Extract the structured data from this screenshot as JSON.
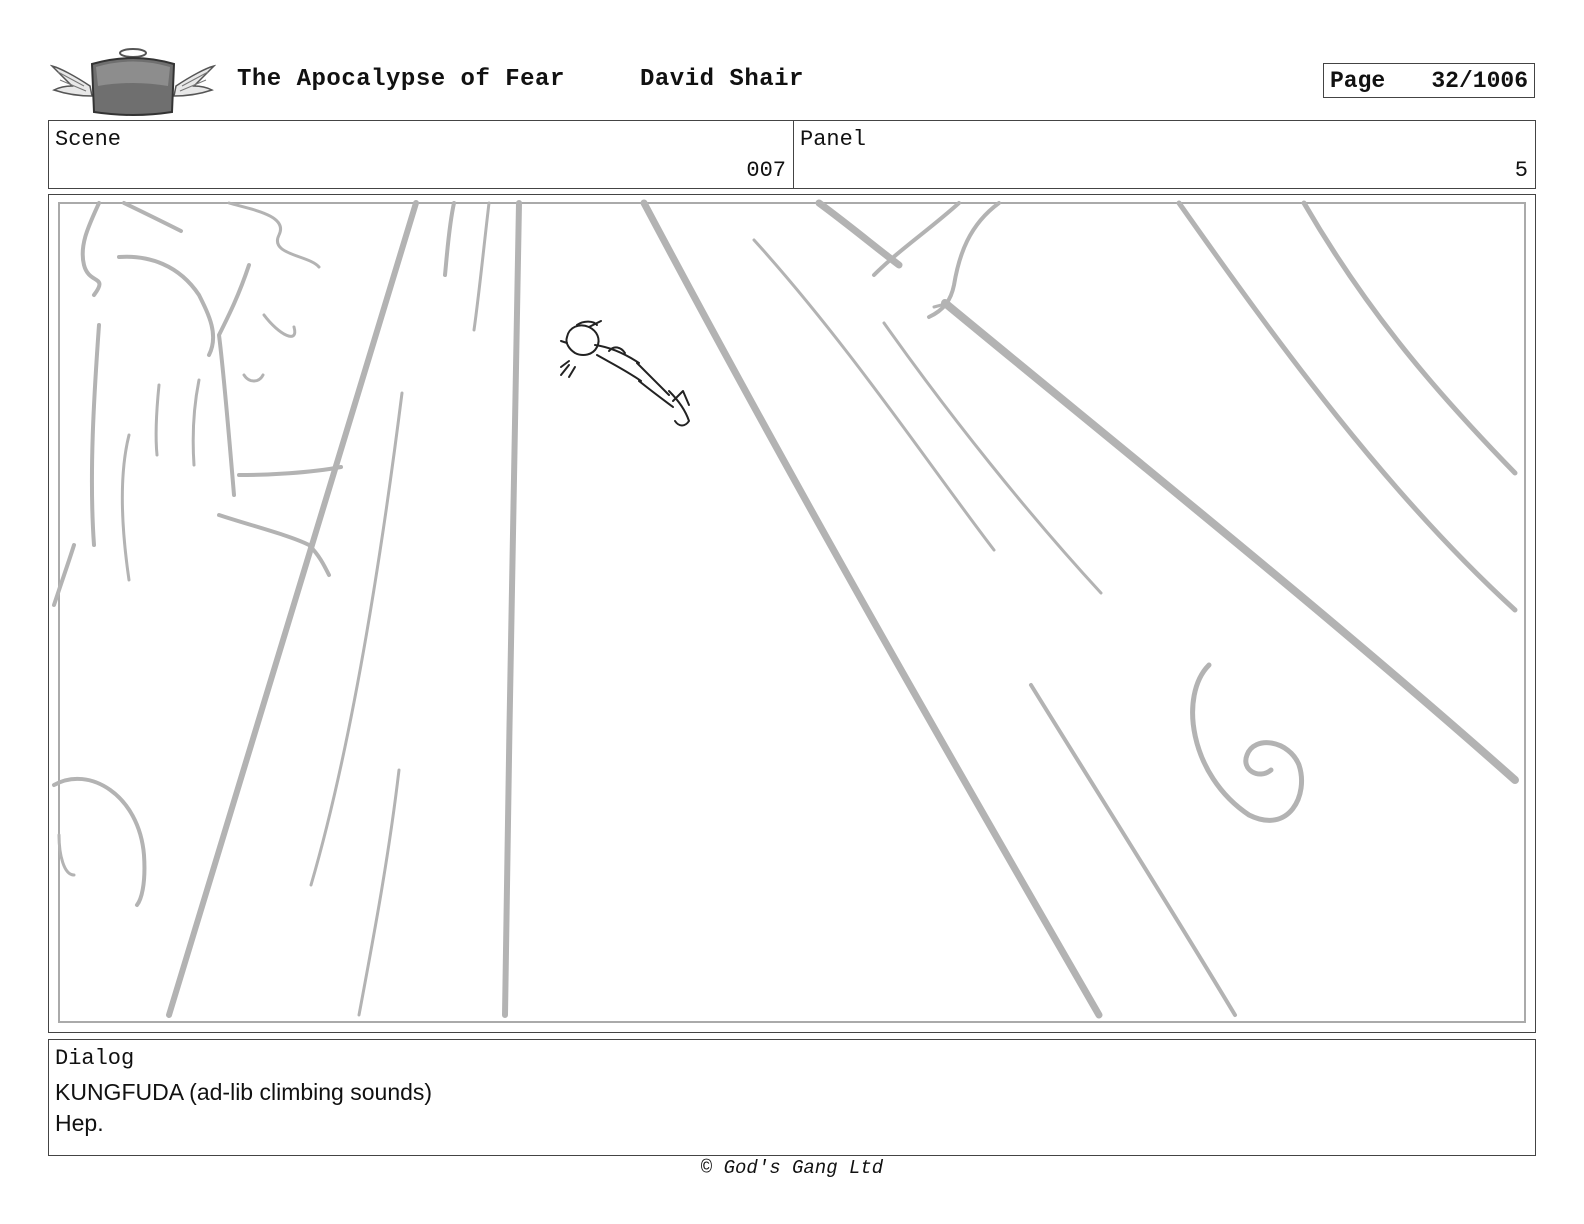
{
  "header": {
    "logo_text": "GOD'S GANG",
    "title": "The Apocalypse of Fear",
    "author": "David Shair",
    "page_label": "Page",
    "page_value": "32/1006"
  },
  "meta": {
    "scene_label": "Scene",
    "scene_value": "007",
    "panel_label": "Panel",
    "panel_value": "5"
  },
  "dialog": {
    "label": "Dialog",
    "lines": [
      "KUNGFUDA (ad-lib climbing sounds)",
      "Hep."
    ]
  },
  "footer": {
    "copyright": "© God's Gang Ltd"
  },
  "colors": {
    "sketch_gray": "#b3b3b3",
    "ink": "#222222",
    "border": "#444444"
  }
}
